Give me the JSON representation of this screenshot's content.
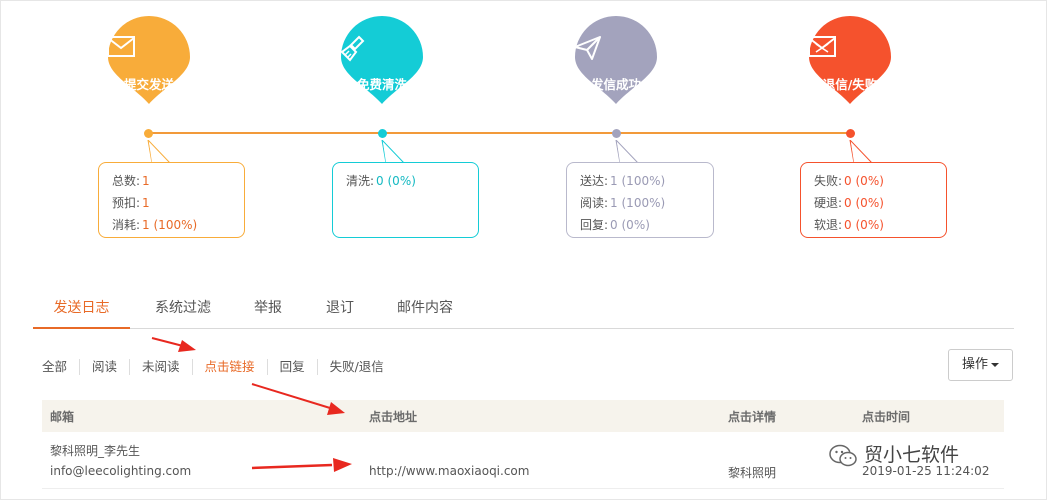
{
  "colors": {
    "submit": "#f8ac3a",
    "clean": "#14ccd6",
    "success": "#a3a3bd",
    "fail": "#f5522d",
    "accent": "#e86a27",
    "arrow": "#e8281f"
  },
  "stages": [
    {
      "label": "提交发送",
      "icon": "mail-icon",
      "stats": [
        {
          "label": "总数:",
          "value": "1"
        },
        {
          "label": "预扣:",
          "value": "1"
        },
        {
          "label": "消耗:",
          "value": "1 (100%)"
        }
      ]
    },
    {
      "label": "免费清洗",
      "icon": "broom-icon",
      "stats": [
        {
          "label": "清洗:",
          "value": "0 (0%)"
        }
      ]
    },
    {
      "label": "发信成功",
      "icon": "paper-plane-icon",
      "stats": [
        {
          "label": "送达:",
          "value": "1 (100%)"
        },
        {
          "label": "阅读:",
          "value": "1 (100%)"
        },
        {
          "label": "回复:",
          "value": "0 (0%)"
        }
      ]
    },
    {
      "label": "退信/失败",
      "icon": "mail-failed-icon",
      "stats": [
        {
          "label": "失败:",
          "value": "0 (0%)"
        },
        {
          "label": "硬退:",
          "value": "0 (0%)"
        },
        {
          "label": "软退:",
          "value": "0 (0%)"
        }
      ]
    }
  ],
  "tabs": [
    "发送日志",
    "系统过滤",
    "举报",
    "退订",
    "邮件内容"
  ],
  "active_tab": "发送日志",
  "filters": [
    "全部",
    "阅读",
    "未阅读",
    "点击链接",
    "回复",
    "失败/退信"
  ],
  "active_filter": "点击链接",
  "operations_label": "操作",
  "table": {
    "headers": [
      "邮箱",
      "点击地址",
      "点击详情",
      "点击时间"
    ],
    "rows": [
      {
        "name": "黎科照明_李先生",
        "email": "info@leecolighting.com",
        "url": "http://www.maoxiaoqi.com",
        "detail": "黎科照明",
        "time": "2019-01-25 11:24:02"
      }
    ]
  },
  "watermark": "贸小七软件"
}
